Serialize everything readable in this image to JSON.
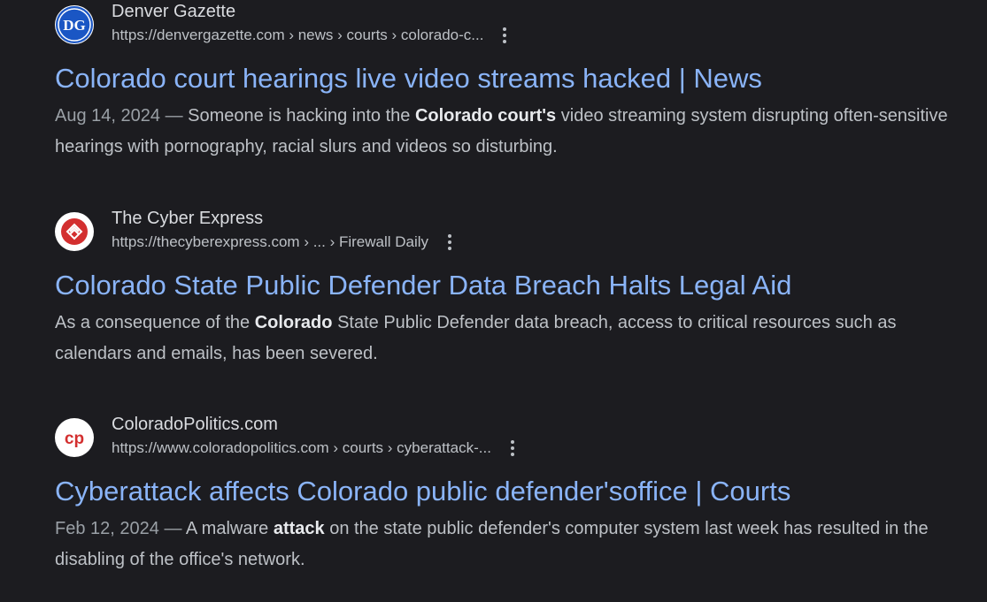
{
  "results": [
    {
      "site_name": "Denver Gazette",
      "url": "https://denvergazette.com › news › courts › colorado-c...",
      "title": "Colorado court hearings live video streams hacked | News",
      "date": "Aug 14, 2024",
      "separator": "—",
      "snippet_pre": "Someone is hacking into the",
      "snippet_bold": "Colorado court's",
      "snippet_post": "video streaming system disrupting often-sensitive hearings with pornography, racial slurs and videos so disturbing.",
      "favicon": "denver-gazette-logo",
      "favicon_text": "DG"
    },
    {
      "site_name": "The Cyber Express",
      "url": "https://thecyberexpress.com › ... › Firewall Daily",
      "title": "Colorado State Public Defender Data Breach Halts Legal Aid",
      "snippet_pre": "As a consequence of the",
      "snippet_bold": "Colorado",
      "snippet_post": "State Public Defender data breach, access to critical resources such as calendars and emails, has been severed.",
      "favicon": "cyber-express-logo"
    },
    {
      "site_name": "ColoradoPolitics.com",
      "url": "https://www.coloradopolitics.com › courts › cyberattack-...",
      "title": "Cyberattack affects Colorado public defender'soffice | Courts",
      "date": "Feb 12, 2024",
      "separator": "—",
      "snippet_pre": "A malware",
      "snippet_bold": "attack",
      "snippet_post": "on the state public defender's computer system last week has resulted in the disabling of the office's network.",
      "favicon": "colorado-politics-logo",
      "favicon_text": "cp"
    }
  ],
  "colors": {
    "background": "#1c1c20",
    "link": "#8ab4f8",
    "text": "#bdc1c6",
    "site_name": "#dadce0"
  },
  "icons": {
    "more": "three-dots-vertical-icon"
  }
}
